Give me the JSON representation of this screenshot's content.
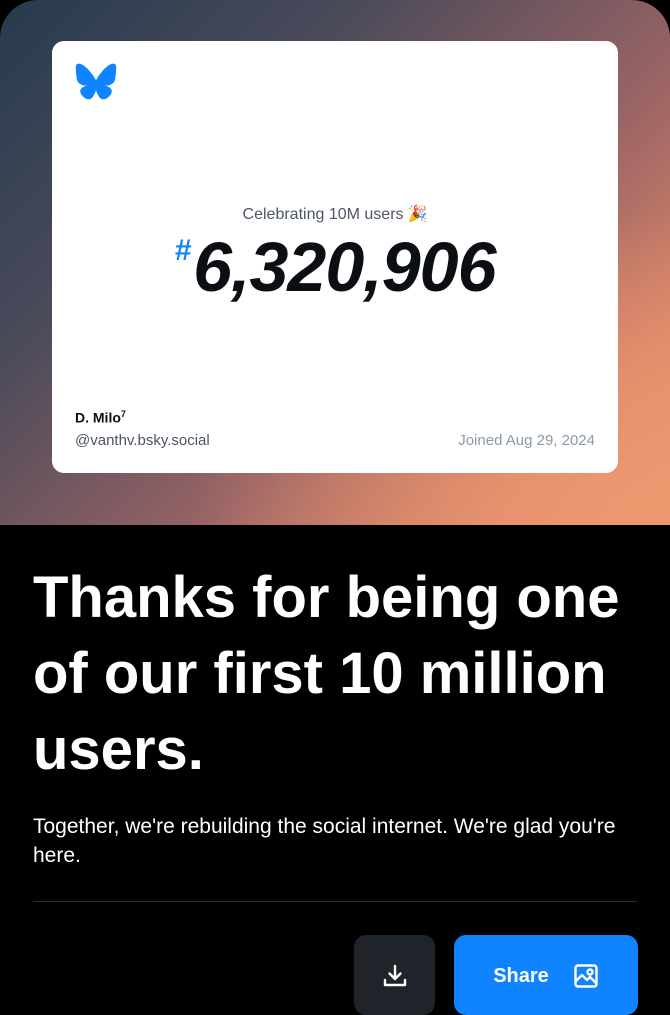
{
  "card": {
    "logo_icon": "butterfly-icon",
    "celebrating_text": "Celebrating 10M users",
    "celebrating_emoji": "🎉",
    "hash_symbol": "#",
    "user_number": "6,320,906",
    "display_name": "D. Milo",
    "display_name_sup": "7",
    "handle": "@vanthv.bsky.social",
    "joined": "Joined Aug 29, 2024"
  },
  "main": {
    "headline": "Thanks for being one of our first 10 million users.",
    "subtext": "Together, we're rebuilding the social internet. We're glad you're here."
  },
  "actions": {
    "download_icon": "download-icon",
    "share_label": "Share",
    "share_icon": "image-icon"
  },
  "colors": {
    "accent": "#1083fe",
    "background": "#000000",
    "card": "#ffffff"
  }
}
